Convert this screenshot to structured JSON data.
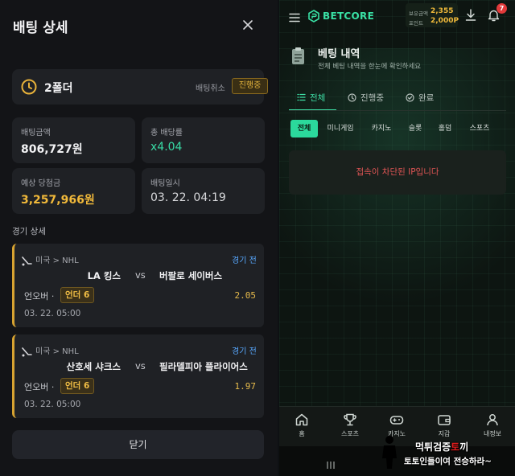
{
  "bet_detail": {
    "title": "배팅 상세",
    "fold": {
      "title": "2폴더",
      "cancel_label": "배팅취소",
      "status": "진행중"
    },
    "stats": [
      {
        "label": "배팅금액",
        "value": "806,727원"
      },
      {
        "label": "총 배당률",
        "value": "x4.04"
      },
      {
        "label": "예상 당첨금",
        "value": "3,257,966원"
      },
      {
        "label": "배팅일시",
        "value": "03. 22. 04:19"
      }
    ],
    "section_label": "경기 상세",
    "matches": [
      {
        "league": "미국 > NHL",
        "state": "경기 전",
        "home": "LA 킹스",
        "vs": "vs",
        "away": "버팔로 세이버스",
        "market": "언오버 ·",
        "pick": "언더 6",
        "odds": "2.05",
        "date": "03. 22. 05:00"
      },
      {
        "league": "미국 > NHL",
        "state": "경기 전",
        "home": "산호세 샤크스",
        "vs": "vs",
        "away": "필라델피아 플라이어스",
        "market": "언오버 ·",
        "pick": "언더 6",
        "odds": "1.97",
        "date": "03. 22. 05:00"
      }
    ],
    "close_label": "닫기"
  },
  "app": {
    "logo": "BETCORE",
    "balance": {
      "label1": "보유금액",
      "value1": "2,355",
      "label2": "포인트",
      "value2": "2,000P"
    },
    "notification_count": "7",
    "page_title": "베팅 내역",
    "page_subtitle": "전체 베팅 내역을 한눈에 확인하세요",
    "tabs": [
      "전체",
      "진행중",
      "완료"
    ],
    "chips": [
      "전체",
      "미니게임",
      "카지노",
      "슬롯",
      "홀덤",
      "스포츠"
    ],
    "alert": "접속이 차단된 IP입니다",
    "nav": [
      "홈",
      "스포츠",
      "카지노",
      "지갑",
      "내정보"
    ]
  },
  "watermark": {
    "line1_white": "먹튀검증",
    "line1_red": "토",
    "line1_end": "끼",
    "line2": "토토인들이여 전승하라~"
  },
  "colors": {
    "accent_green": "#3ee0a6",
    "gold": "#f1b93a",
    "alert_red": "#e05555"
  }
}
